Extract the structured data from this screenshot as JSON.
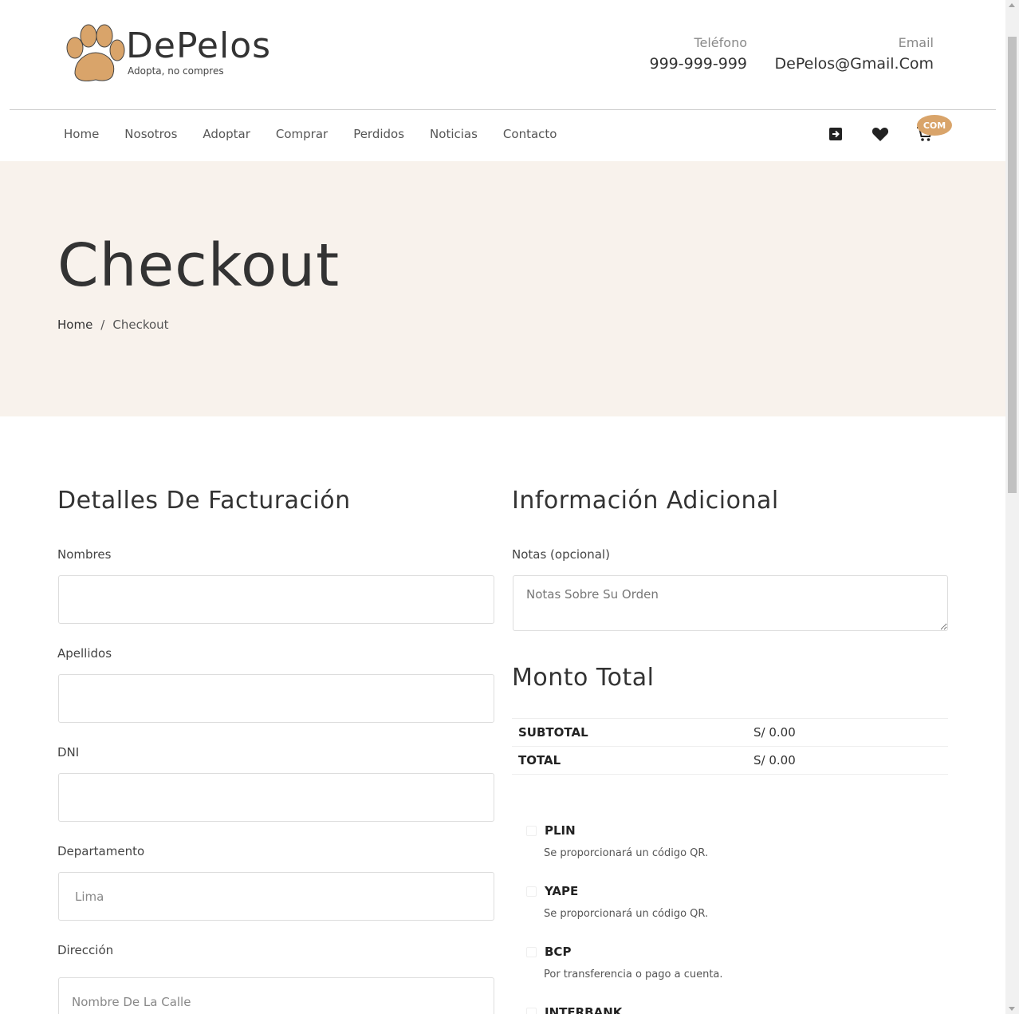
{
  "brand": {
    "name": "DePelos",
    "tagline": "Adopta, no compres"
  },
  "contact": {
    "phone_label": "Teléfono",
    "phone_value": "999-999-999",
    "email_label": "Email",
    "email_value": "DePelos@Gmail.Com"
  },
  "nav": {
    "items": [
      "Home",
      "Nosotros",
      "Adoptar",
      "Comprar",
      "Perdidos",
      "Noticias",
      "Contacto"
    ],
    "cart_badge": "COM"
  },
  "hero": {
    "title": "Checkout",
    "breadcrumb_home": "Home",
    "breadcrumb_sep": "/",
    "breadcrumb_current": "Checkout"
  },
  "billing": {
    "title": "Detalles De Facturación",
    "fields": [
      {
        "label": "Nombres",
        "placeholder": "",
        "value": ""
      },
      {
        "label": "Apellidos",
        "placeholder": "",
        "value": ""
      },
      {
        "label": "DNI",
        "placeholder": "",
        "value": ""
      },
      {
        "label": "Departamento",
        "placeholder": "",
        "value": "Lima"
      },
      {
        "label": "Dirección",
        "placeholder": "Nombre De La Calle",
        "value": ""
      }
    ]
  },
  "additional": {
    "title": "Información Adicional",
    "notes_label": "Notas (opcional)",
    "notes_placeholder": "Notas Sobre Su Orden"
  },
  "totals": {
    "title": "Monto Total",
    "subtotal_label": "SUBTOTAL",
    "subtotal_value": "S/ 0.00",
    "total_label": "TOTAL",
    "total_value": "S/ 0.00"
  },
  "payments": [
    {
      "name": "PLIN",
      "desc": "Se proporcionará un código QR."
    },
    {
      "name": "YAPE",
      "desc": "Se proporcionará un código QR."
    },
    {
      "name": "BCP",
      "desc": "Por transferencia o pago a cuenta."
    },
    {
      "name": "INTERBANK",
      "desc": ""
    }
  ],
  "colors": {
    "accent": "#d9a46a",
    "hero_bg": "#f8f2ec"
  }
}
